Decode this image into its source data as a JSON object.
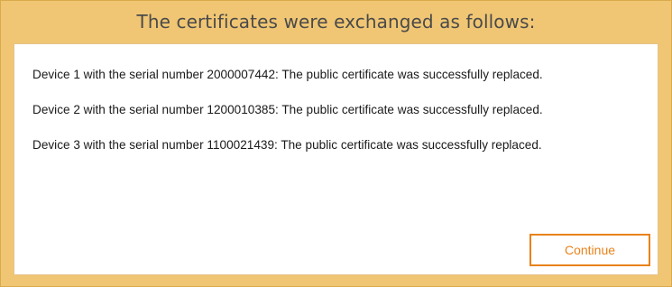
{
  "dialog": {
    "title": "The certificates were exchanged as follows:",
    "messages": [
      "Device 1 with the serial number 2000007442: The public certificate was successfully replaced.",
      "Device 2 with the serial number 1200010385: The public certificate was successfully replaced.",
      "Device 3 with the serial number 1100021439: The public certificate was successfully replaced."
    ],
    "continue_label": "Continue"
  },
  "colors": {
    "frame_background": "#f0c674",
    "frame_border": "#d9a94a",
    "content_background": "#ffffff",
    "accent": "#e8821a",
    "title_text": "#4a4a4a",
    "body_text": "#1a1a1a"
  }
}
